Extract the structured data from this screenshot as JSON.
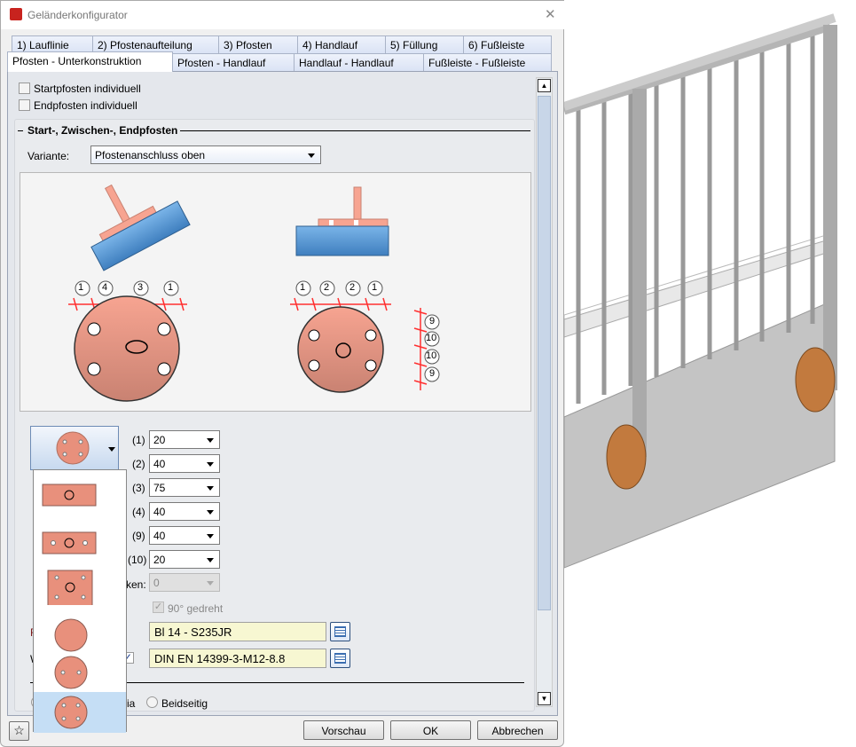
{
  "window": {
    "title": "Geländerkonfigurator",
    "close": "✕"
  },
  "tabs_row1": [
    {
      "label": "1) Lauflinie"
    },
    {
      "label": "2) Pfostenaufteilung"
    },
    {
      "label": "3) Pfosten"
    },
    {
      "label": "4) Handlauf"
    },
    {
      "label": "5) Füllung"
    },
    {
      "label": "6) Fußleiste"
    }
  ],
  "tabs_row2": [
    {
      "label": "Pfosten - Unterkonstruktion",
      "active": true
    },
    {
      "label": "Pfosten - Handlauf"
    },
    {
      "label": "Handlauf - Handlauf"
    },
    {
      "label": "Fußleiste - Fußleiste"
    }
  ],
  "options": {
    "start_individual": "Startpfosten individuell",
    "end_individual": "Endpfosten individuell"
  },
  "group": {
    "title": "Start-, Zwischen-, Endpfosten",
    "variant_label": "Variante:",
    "variant_value": "Pfostenanschluss oben"
  },
  "diagram": {
    "left_dims": [
      "1",
      "4",
      "3",
      "1"
    ],
    "right_dims": [
      "1",
      "2",
      "2",
      "1"
    ],
    "right_vertical_dims": [
      "9",
      "10",
      "10",
      "9"
    ]
  },
  "dims": [
    {
      "label": "(1)",
      "value": "20"
    },
    {
      "label": "(2)",
      "value": "40"
    },
    {
      "label": "(3)",
      "value": "75"
    },
    {
      "label": "(4)",
      "value": "40"
    },
    {
      "label": "(9)",
      "value": "40"
    },
    {
      "label": "(10)",
      "value": "20"
    }
  ],
  "disabled_field": {
    "label": "ken:",
    "value": "0"
  },
  "rotated": {
    "label": "90° gedreht",
    "checked": true
  },
  "material": {
    "label": "F",
    "value": "Bl 14 - S235JR"
  },
  "bolt": {
    "label": "W",
    "value": "DIN EN 14399-3-M12-8.8"
  },
  "radio": {
    "left_label": "ia",
    "right_label": "Beidseitig"
  },
  "plate_options": [
    "rect-single-hole",
    "rect-three-holes",
    "rect-four-holes-center",
    "round-plain",
    "round-two-holes",
    "round-four-holes"
  ],
  "selected_plate": "round-four-holes",
  "buttons": {
    "preview": "Vorschau",
    "ok": "OK",
    "cancel": "Abbrechen"
  },
  "colors": {
    "plate": "#e8907c",
    "beam": "#5b9bd5",
    "dim": "#ff3030",
    "selected": "#c5def5",
    "field": "#f7f7d2"
  }
}
